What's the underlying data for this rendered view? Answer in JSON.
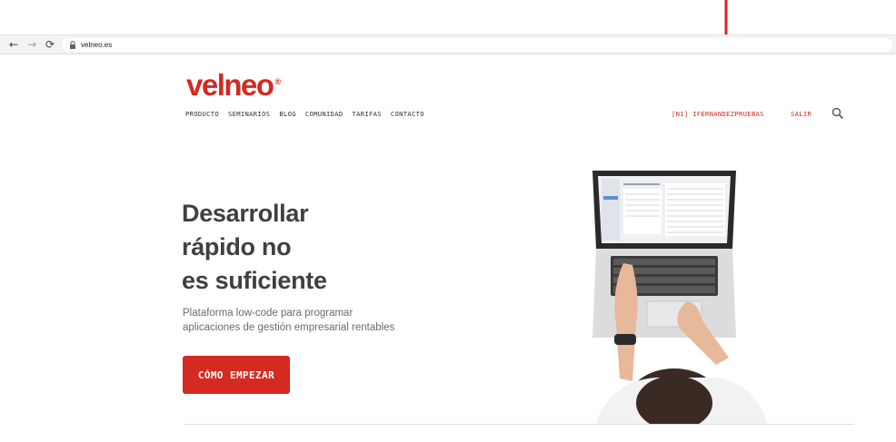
{
  "browser": {
    "url": "velneo.es"
  },
  "header": {
    "logo_text": "velneo",
    "logo_mark": "®",
    "nav_items": [
      {
        "label": "PRODUCTO"
      },
      {
        "label": "SEMINARIOS"
      },
      {
        "label": "BLOG"
      },
      {
        "label": "COMUNIDAD"
      },
      {
        "label": "TARIFAS"
      },
      {
        "label": "CONTACTO"
      }
    ],
    "user_label": "[N1] IFERNANDEZPRUEBAS",
    "logout_label": "SALIR",
    "search_icon": "search-icon"
  },
  "hero": {
    "title_lines": [
      "Desarrollar",
      "rápido no",
      "es suficiente"
    ],
    "subtitle_lines": [
      "Plataforma low-code para programar",
      "aplicaciones de gestión empresarial rentables"
    ],
    "cta_label": "CÓMO EMPEZAR"
  },
  "colors": {
    "brand": "#d42a21",
    "heading": "#404040",
    "body_text": "#6b6b6b"
  }
}
